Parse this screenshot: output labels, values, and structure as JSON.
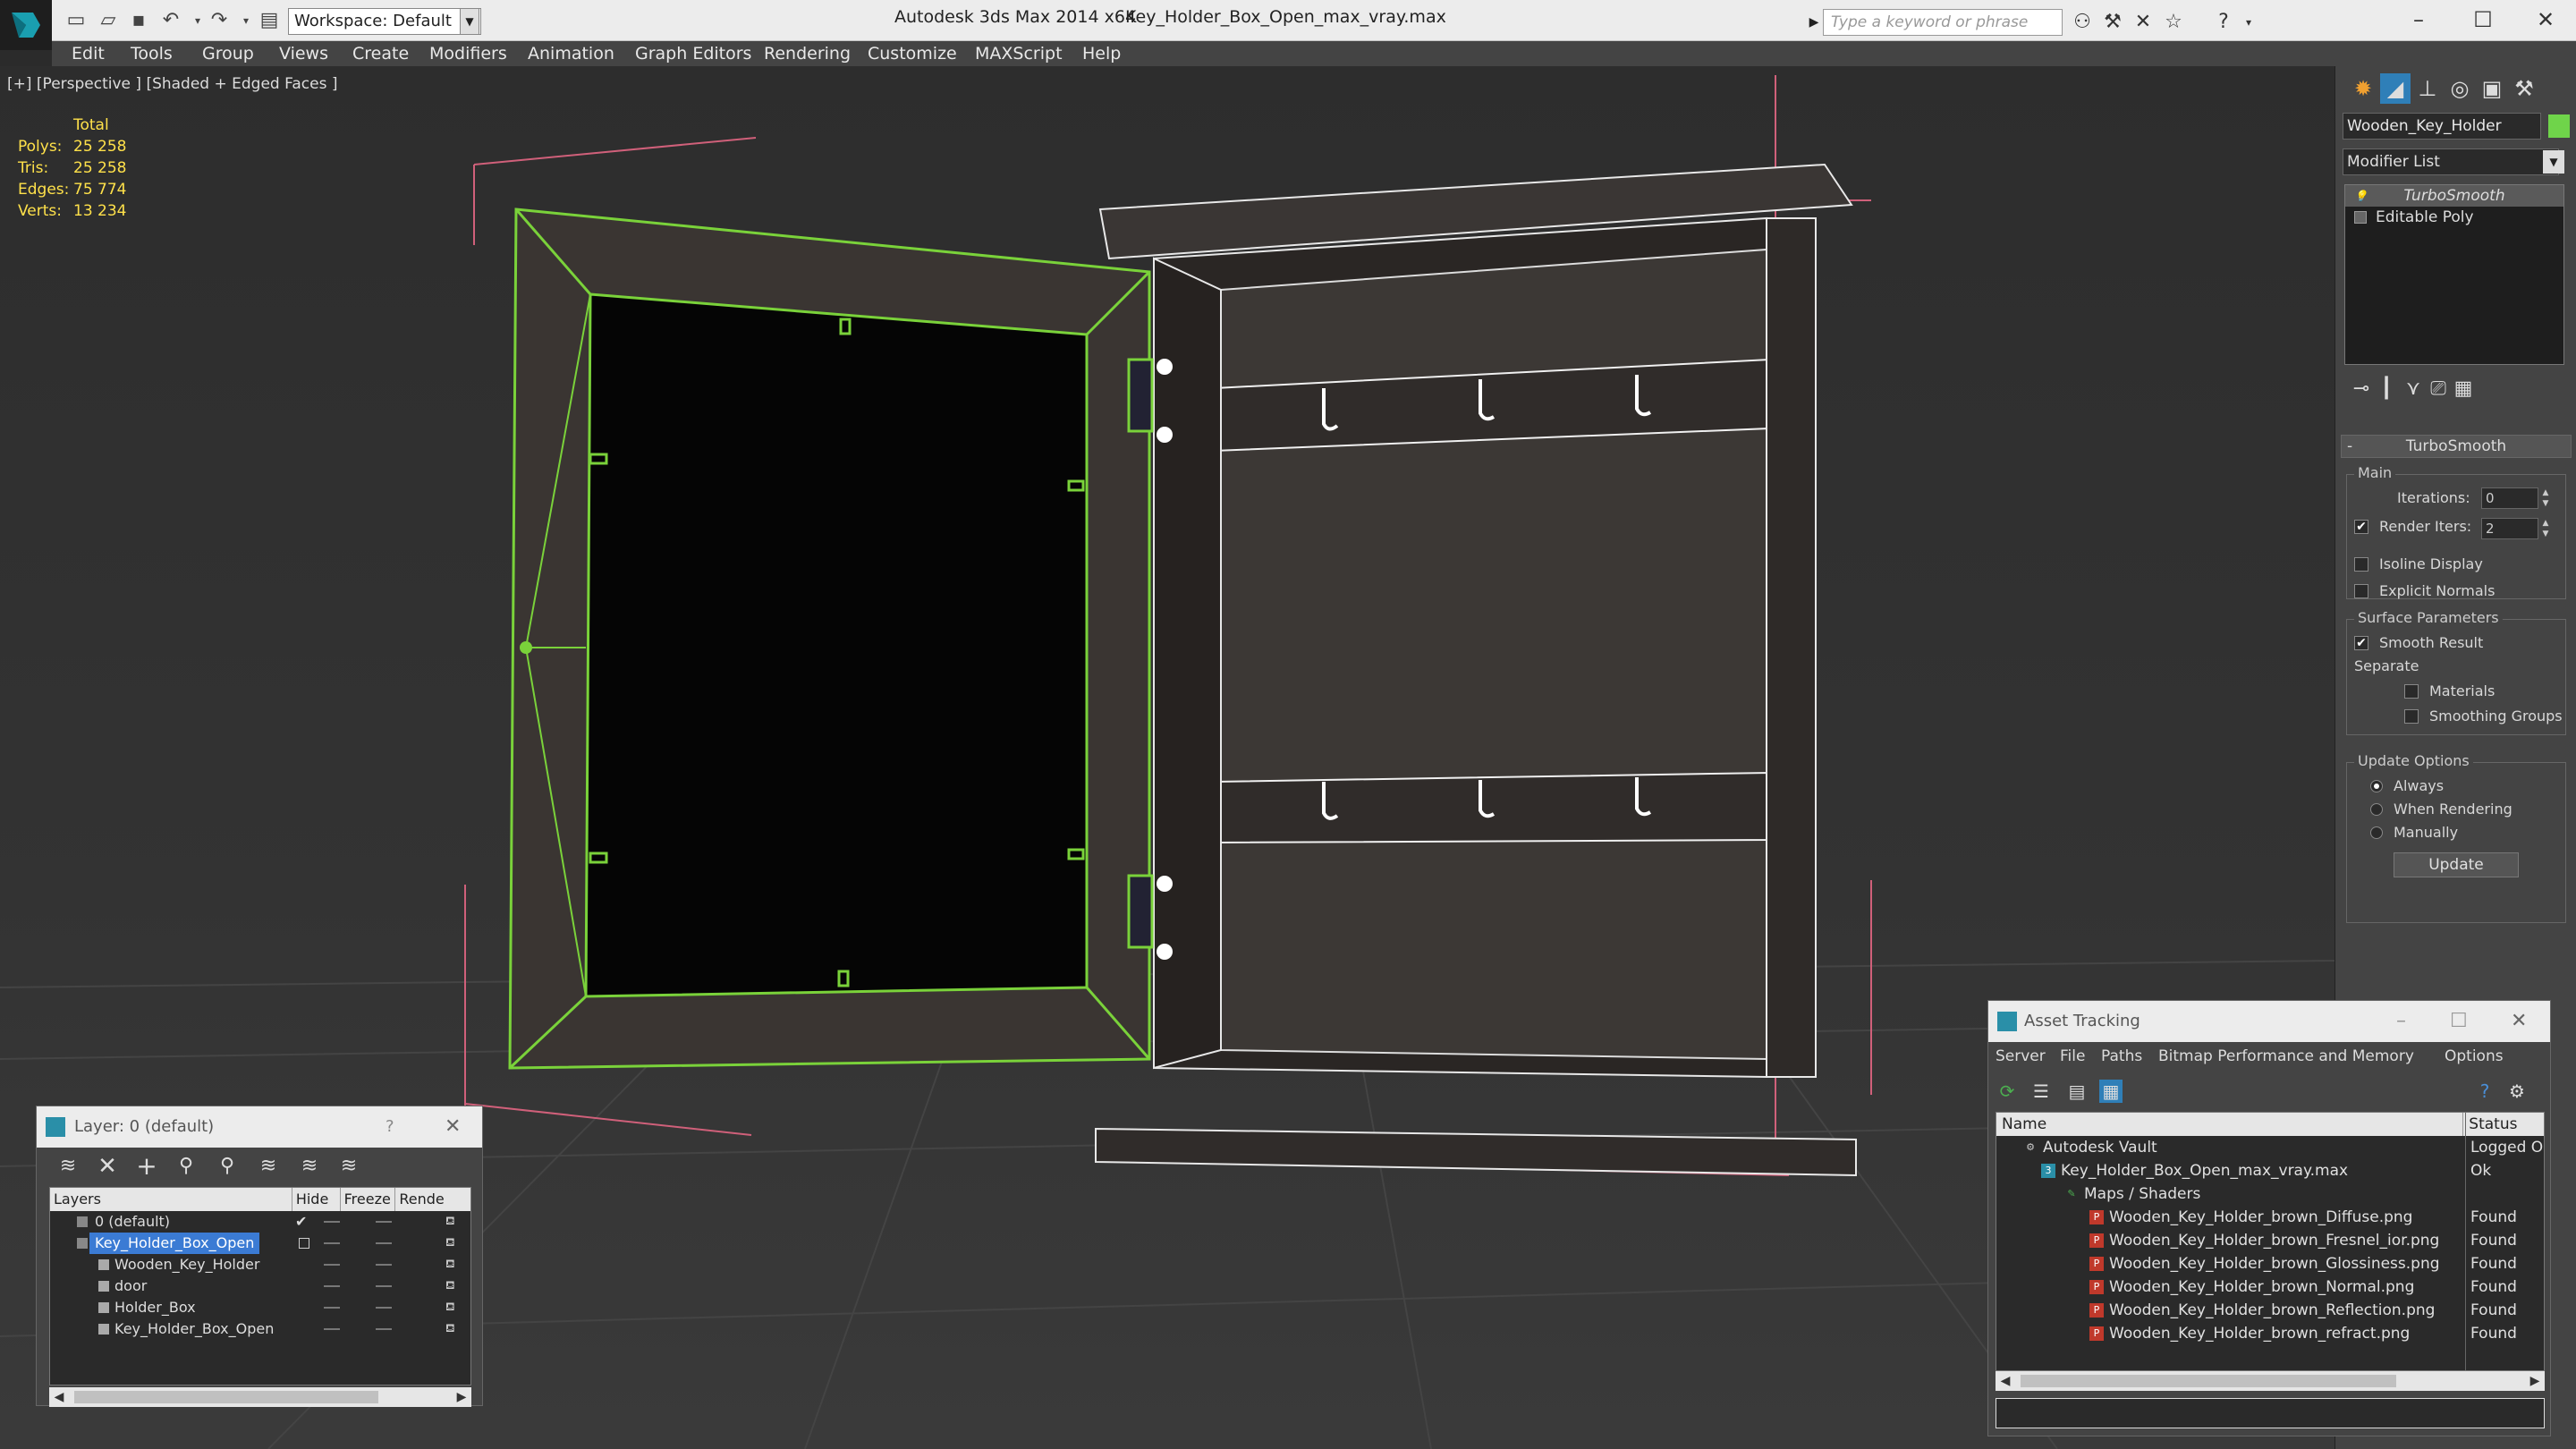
{
  "titlebar": {
    "workspace": "Workspace: Default",
    "app_title": "Autodesk 3ds Max  2014 x64",
    "file_title": "Key_Holder_Box_Open_max_vray.max",
    "search_placeholder": "Type a keyword or phrase"
  },
  "menu": [
    "Edit",
    "Tools",
    "Group",
    "Views",
    "Create",
    "Modifiers",
    "Animation",
    "Graph Editors",
    "Rendering",
    "Customize",
    "MAXScript",
    "Help"
  ],
  "viewport": {
    "label": "[+] [Perspective ] [Shaded + Edged Faces ]",
    "stats": {
      "total_label": "Total",
      "rows": [
        {
          "label": "Polys:",
          "value": "25 258"
        },
        {
          "label": "Tris:",
          "value": "25 258"
        },
        {
          "label": "Edges:",
          "value": "75 774"
        },
        {
          "label": "Verts:",
          "value": "13 234"
        }
      ]
    }
  },
  "command_panel": {
    "object_name": "Wooden_Key_Holder",
    "object_color": "#6fd44a",
    "modifier_list": "Modifier List",
    "stack": [
      "TurboSmooth",
      "Editable Poly"
    ],
    "turbosmooth": {
      "title": "TurboSmooth",
      "main_label": "Main",
      "iterations_label": "Iterations:",
      "iterations_value": "0",
      "render_iters_label": "Render Iters:",
      "render_iters_value": "2",
      "isoline_label": "Isoline Display",
      "explicit_label": "Explicit Normals",
      "surface_label": "Surface Parameters",
      "smooth_label": "Smooth Result",
      "separate_label": "Separate",
      "materials_label": "Materials",
      "smoothing_groups_label": "Smoothing Groups",
      "update_options_label": "Update Options",
      "always_label": "Always",
      "when_rendering_label": "When Rendering",
      "manually_label": "Manually",
      "update_button": "Update"
    }
  },
  "layer_window": {
    "title": "Layer: 0 (default)",
    "help": "?",
    "columns": [
      "Layers",
      "Hide",
      "Freeze",
      "Rende"
    ],
    "rows": [
      {
        "name": "0 (default)",
        "indent": 0,
        "type": "layer"
      },
      {
        "name": "Key_Holder_Box_Open",
        "indent": 0,
        "type": "layer"
      },
      {
        "name": "Wooden_Key_Holder",
        "indent": 1,
        "type": "object"
      },
      {
        "name": "door",
        "indent": 1,
        "type": "object"
      },
      {
        "name": "Holder_Box",
        "indent": 1,
        "type": "object"
      },
      {
        "name": "Key_Holder_Box_Open",
        "indent": 1,
        "type": "object"
      }
    ]
  },
  "asset_tracking": {
    "title": "Asset Tracking",
    "menu": [
      "Server",
      "File",
      "Paths",
      "Bitmap Performance and Memory",
      "Options"
    ],
    "columns": [
      "Name",
      "Status"
    ],
    "rows": [
      {
        "name": "Autodesk Vault",
        "status": "Logged Ou",
        "indent": 1
      },
      {
        "name": "Key_Holder_Box_Open_max_vray.max",
        "status": "Ok",
        "indent": 2
      },
      {
        "name": "Maps / Shaders",
        "status": "",
        "indent": 3
      },
      {
        "name": "Wooden_Key_Holder_brown_Diffuse.png",
        "status": "Found",
        "indent": 4
      },
      {
        "name": "Wooden_Key_Holder_brown_Fresnel_ior.png",
        "status": "Found",
        "indent": 4
      },
      {
        "name": "Wooden_Key_Holder_brown_Glossiness.png",
        "status": "Found",
        "indent": 4
      },
      {
        "name": "Wooden_Key_Holder_brown_Normal.png",
        "status": "Found",
        "indent": 4
      },
      {
        "name": "Wooden_Key_Holder_brown_Reflection.png",
        "status": "Found",
        "indent": 4
      },
      {
        "name": "Wooden_Key_Holder_brown_refract.png",
        "status": "Found",
        "indent": 4
      }
    ]
  }
}
